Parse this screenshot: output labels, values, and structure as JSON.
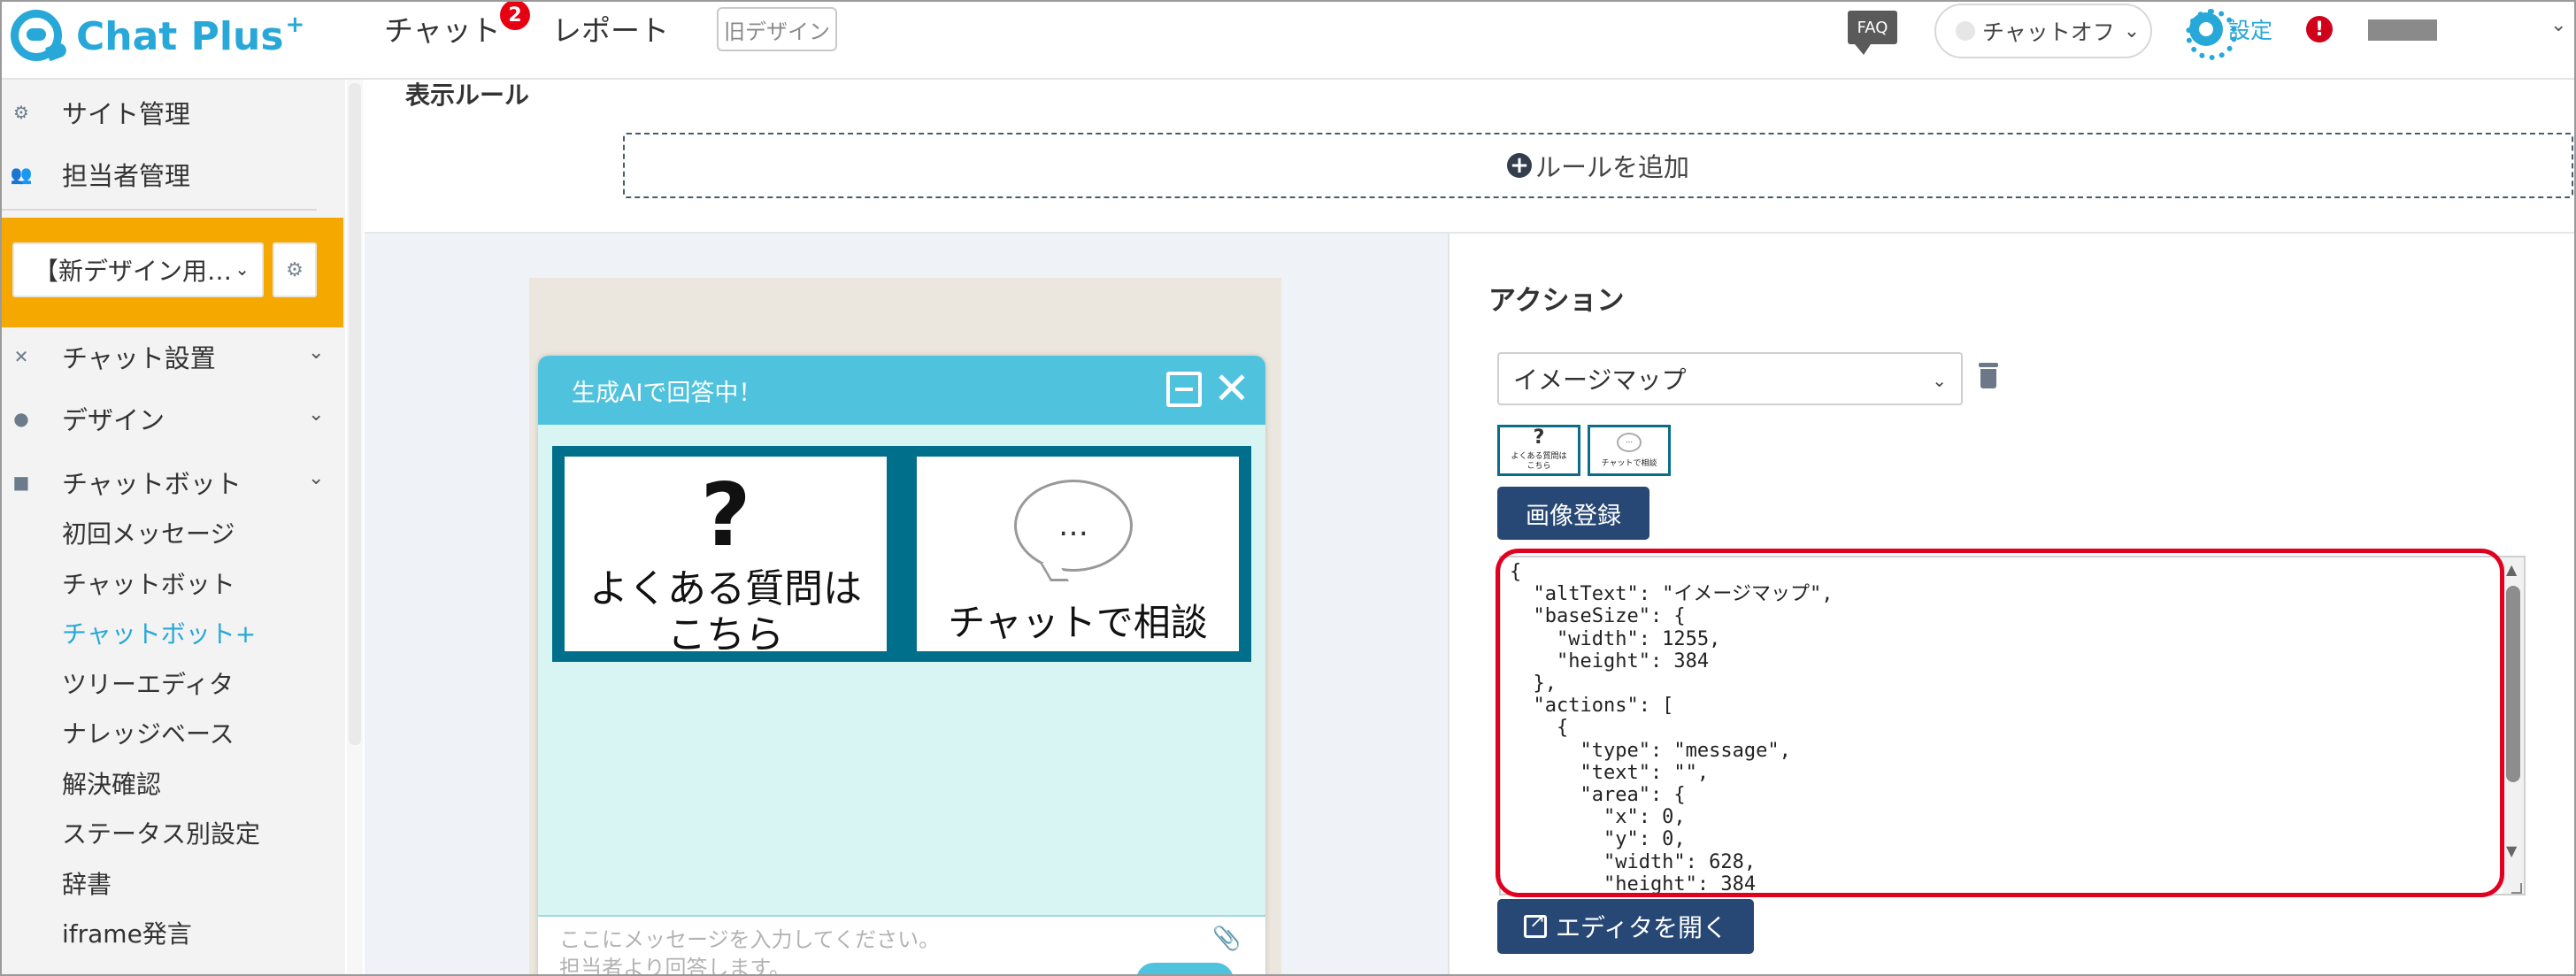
{
  "header": {
    "logo_text": "Chat Plus",
    "logo_sup": "+",
    "nav_chat": "チャット",
    "nav_chat_badge": "2",
    "nav_report": "レポート",
    "old_design": "旧デザイン",
    "faq": "FAQ",
    "chat_status": "チャットオフ",
    "settings": "設定",
    "alert": "!"
  },
  "sidebar": {
    "site_management": "サイト管理",
    "staff_management": "担当者管理",
    "site_select": "【新デザイン用…",
    "chat_settings": "チャット設置",
    "design": "デザイン",
    "chatbot": "チャットボット",
    "sub_items": [
      "初回メッセージ",
      "チャットボット",
      "チャットボット+",
      "ツリーエディタ",
      "ナレッジベース",
      "解決確認",
      "ステータス別設定",
      "辞書",
      "iframe発言"
    ]
  },
  "main": {
    "section_title": "表示ルール",
    "add_rule": "ルールを追加",
    "preview": {
      "header_title": "生成AIで回答中！",
      "cell_left_mark": "?",
      "cell_left_line1": "よくある質問は",
      "cell_left_line2": "こちら",
      "cell_right_bubble": "…",
      "cell_right_text": "チャットで相談",
      "input_placeholder_1": "ここにメッセージを入力してください。",
      "input_placeholder_2": "担当者より回答します。"
    },
    "action": {
      "title": "アクション",
      "select_value": "イメージマップ",
      "thumb1_mark": "?",
      "thumb1_text": "よくある質問は\nこちら",
      "thumb2_bubble": "…",
      "thumb2_text": "チャットで相談",
      "register_button": "画像登録",
      "json_text": "{\n  \"altText\": \"イメージマップ\",\n  \"baseSize\": {\n    \"width\": 1255,\n    \"height\": 384\n  },\n  \"actions\": [\n    {\n      \"type\": \"message\",\n      \"text\": \"\",\n      \"area\": {\n        \"x\": 0,\n        \"y\": 0,\n        \"width\": 628,\n        \"height\": 384",
      "open_editor": "エディタを開く"
    }
  }
}
